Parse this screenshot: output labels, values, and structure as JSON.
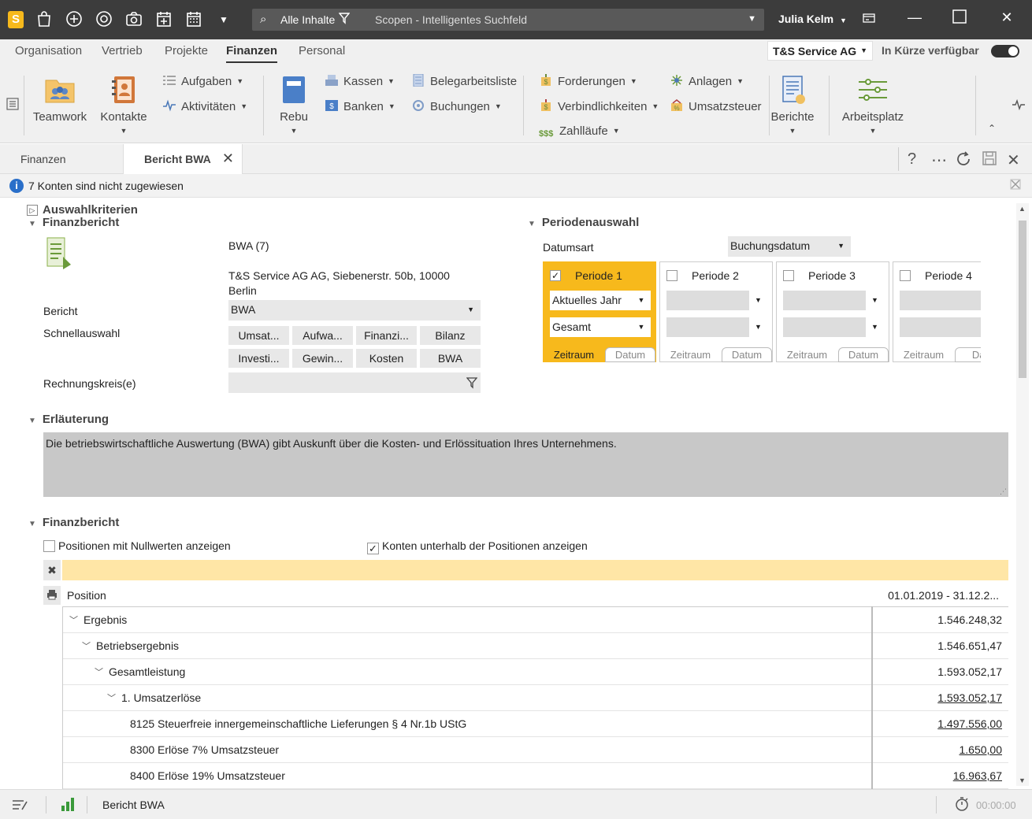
{
  "titlebar": {
    "search_scope": "Alle Inhalte",
    "search_placeholder": "Scopen - Intelligentes Suchfeld",
    "user": "Julia Kelm"
  },
  "menu": {
    "items": [
      "Organisation",
      "Vertrieb",
      "Projekte",
      "Finanzen",
      "Personal"
    ],
    "active": "Finanzen",
    "company": "T&S Service AG",
    "soon_label": "In Kürze verfügbar"
  },
  "ribbon": {
    "teamwork": "Teamwork",
    "kontakte": "Kontakte",
    "aufgaben": "Aufgaben",
    "aktivitaeten": "Aktivitäten",
    "rebu": "Rebu",
    "kassen": "Kassen",
    "banken": "Banken",
    "belegarbeitsliste": "Belegarbeitsliste",
    "buchungen": "Buchungen",
    "forderungen": "Forderungen",
    "verbindlichkeiten": "Verbindlichkeiten",
    "zahllaeufe": "Zahlläufe",
    "anlagen": "Anlagen",
    "umsatzsteuer": "Umsatzsteuer",
    "berichte": "Berichte",
    "arbeitsplatz": "Arbeitsplatz"
  },
  "tabs": {
    "first": "Finanzen",
    "active": "Bericht BWA"
  },
  "info": {
    "message": "7 Konten sind nicht zugewiesen"
  },
  "form": {
    "auswahl_title": "Auswahlkriterien",
    "finanzbericht_title": "Finanzbericht",
    "report_name": "BWA (7)",
    "company_address": "T&S Service AG AG, Siebenerstr. 50b, 10000",
    "company_city": "Berlin",
    "bericht_label": "Bericht",
    "bericht_value": "BWA",
    "schnellauswahl_label": "Schnellauswahl",
    "quick_buttons": [
      "Umsat...",
      "Aufwa...",
      "Finanzi...",
      "Bilanz",
      "Investi...",
      "Gewin...",
      "Kosten",
      "BWA"
    ],
    "rechnungskreis_label": "Rechnungskreis(e)",
    "perioden_title": "Periodenauswahl",
    "datumsart_label": "Datumsart",
    "datumsart_value": "Buchungsdatum",
    "periods": [
      {
        "title": "Periode 1",
        "checked": true,
        "sel1": "Aktuelles Jahr",
        "sel2": "Gesamt",
        "tab1": "Zeitraum",
        "tab2": "Datum"
      },
      {
        "title": "Periode 2",
        "checked": false,
        "sel1": "",
        "sel2": "",
        "tab1": "Zeitraum",
        "tab2": "Datum"
      },
      {
        "title": "Periode 3",
        "checked": false,
        "sel1": "",
        "sel2": "",
        "tab1": "Zeitraum",
        "tab2": "Datum"
      },
      {
        "title": "Periode 4",
        "checked": false,
        "sel1": "",
        "sel2": "",
        "tab1": "Zeitraum",
        "tab2": "Dat"
      }
    ],
    "erlaeuterung_title": "Erläuterung",
    "erlaeuterung_text": "Die betriebswirtschaftliche Auswertung (BWA) gibt Auskunft über die Kosten- und Erlössituation Ihres Unternehmens."
  },
  "report": {
    "title": "Finanzbericht",
    "opt_nullwerte": "Positionen mit Nullwerten anzeigen",
    "opt_nullwerte_checked": false,
    "opt_konten": "Konten unterhalb der Positionen anzeigen",
    "opt_konten_checked": true,
    "col_position": "Position",
    "col_period": "01.01.2019 - 31.12.2...",
    "rows": [
      {
        "label": "Ergebnis",
        "value": "1.546.248,32",
        "level": 0,
        "expander": true,
        "underline": false
      },
      {
        "label": "Betriebsergebnis",
        "value": "1.546.651,47",
        "level": 1,
        "expander": true,
        "underline": false
      },
      {
        "label": "Gesamtleistung",
        "value": "1.593.052,17",
        "level": 2,
        "expander": true,
        "underline": false
      },
      {
        "label": "1. Umsatzerlöse",
        "value": "1.593.052,17",
        "level": 3,
        "expander": true,
        "underline": true
      },
      {
        "label": "8125 Steuerfreie innergemeinschaftliche Lieferungen § 4 Nr.1b UStG",
        "value": "1.497.556,00",
        "level": 4,
        "expander": false,
        "underline": true
      },
      {
        "label": "8300 Erlöse 7% Umsatzsteuer",
        "value": "1.650,00",
        "level": 4,
        "expander": false,
        "underline": true
      },
      {
        "label": "8400 Erlöse 19% Umsatzsteuer",
        "value": "16.963,67",
        "level": 4,
        "expander": false,
        "underline": true
      }
    ]
  },
  "status": {
    "tab_name": "Bericht BWA",
    "timer": "00:00:00"
  },
  "colors": {
    "titlebar": "#3c3c3c",
    "accent": "#f7b91c",
    "filter_row": "#ffe6a6",
    "info": "#2a6fc9"
  }
}
